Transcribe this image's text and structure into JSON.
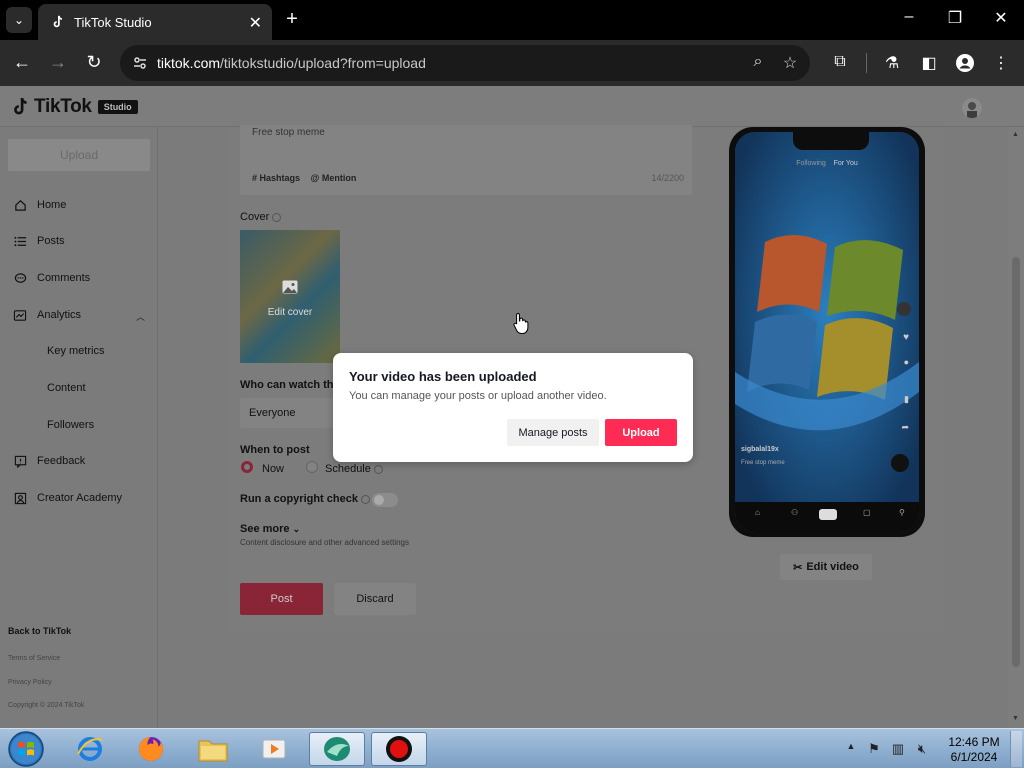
{
  "browser": {
    "tab_title": "TikTok Studio",
    "url_domain": "tiktok.com",
    "url_path": "/tiktokstudio/upload?from=upload"
  },
  "header": {
    "logo_text": "TikTok",
    "studio_badge": "Studio"
  },
  "sidebar": {
    "upload_label": "Upload",
    "items": [
      {
        "label": "Home",
        "icon": "home-icon"
      },
      {
        "label": "Posts",
        "icon": "list-icon"
      },
      {
        "label": "Comments",
        "icon": "comment-icon"
      },
      {
        "label": "Analytics",
        "icon": "analytics-icon"
      },
      {
        "label": "Feedback",
        "icon": "feedback-icon"
      },
      {
        "label": "Creator Academy",
        "icon": "academy-icon"
      }
    ],
    "analytics_sub": [
      "Key metrics",
      "Content",
      "Followers"
    ],
    "back_link": "Back to TikTok",
    "terms": "Terms of Service",
    "privacy": "Privacy Policy",
    "copyright": "Copyright © 2024 TikTok"
  },
  "form": {
    "description": "Free stop meme",
    "hashtags_label": "# Hashtags",
    "mention_label": "@ Mention",
    "char_count": "14/2200",
    "cover_label": "Cover",
    "edit_cover": "Edit cover",
    "who_can_watch_label": "Who can watch thi",
    "who_can_watch_value": "Everyone",
    "when_to_post_label": "When to post",
    "now_label": "Now",
    "schedule_label": "Schedule",
    "copyright_label": "Run a copyright check",
    "see_more": "See more",
    "see_more_sub": "Content disclosure and other advanced settings",
    "post_button": "Post",
    "discard_button": "Discard"
  },
  "preview": {
    "following": "Following",
    "for_you": "For You",
    "username": "sigbalal19x",
    "caption": "Free stop meme",
    "edit_video": "Edit video"
  },
  "modal": {
    "title": "Your video has been uploaded",
    "message": "You can manage your posts or upload another video.",
    "manage_button": "Manage posts",
    "upload_button": "Upload"
  },
  "taskbar": {
    "time": "12:46 PM",
    "date": "6/1/2024"
  },
  "colors": {
    "accent": "#fe2c55",
    "overlay": "#7b7b7b"
  }
}
